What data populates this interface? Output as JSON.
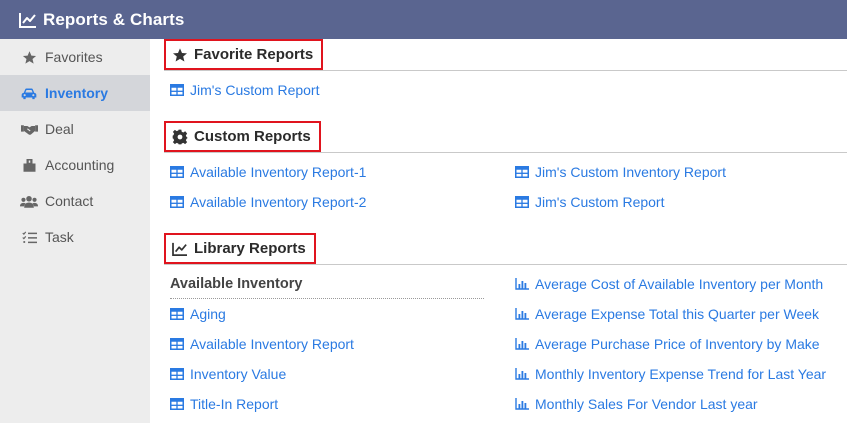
{
  "app": {
    "title": "Reports & Charts",
    "icon": "line-chart-icon"
  },
  "sidebar": {
    "items": [
      {
        "label": "Favorites",
        "icon": "star-icon",
        "active": false
      },
      {
        "label": "Inventory",
        "icon": "car-icon",
        "active": true
      },
      {
        "label": "Deal",
        "icon": "handshake-icon",
        "active": false
      },
      {
        "label": "Accounting",
        "icon": "accounting-icon",
        "active": false
      },
      {
        "label": "Contact",
        "icon": "users-icon",
        "active": false
      },
      {
        "label": "Task",
        "icon": "task-list-icon",
        "active": false
      }
    ]
  },
  "favorite_reports": {
    "heading": "Favorite Reports",
    "links": [
      "Jim's Custom Report"
    ]
  },
  "custom_reports": {
    "heading": "Custom Reports",
    "left": [
      "Available Inventory Report-1",
      "Available Inventory Report-2"
    ],
    "right": [
      "Jim's Custom Inventory Report",
      "Jim's Custom Report"
    ]
  },
  "library_reports": {
    "heading": "Library Reports",
    "subheading": "Available Inventory",
    "left": [
      "Aging",
      "Available Inventory Report",
      "Inventory Value",
      "Title-In Report"
    ],
    "right": [
      "Average Cost of Available Inventory per Month",
      "Average Expense Total this Quarter per Week",
      "Average Purchase Price of Inventory by Make",
      "Monthly Inventory Expense Trend for Last Year",
      "Monthly Sales For Vendor Last year"
    ]
  },
  "colors": {
    "header_bg": "#5a6590",
    "link": "#2a7ae2",
    "highlight_box": "#e0141e",
    "sidebar_bg": "#ededed",
    "sidebar_active_bg": "#d4d6da"
  }
}
